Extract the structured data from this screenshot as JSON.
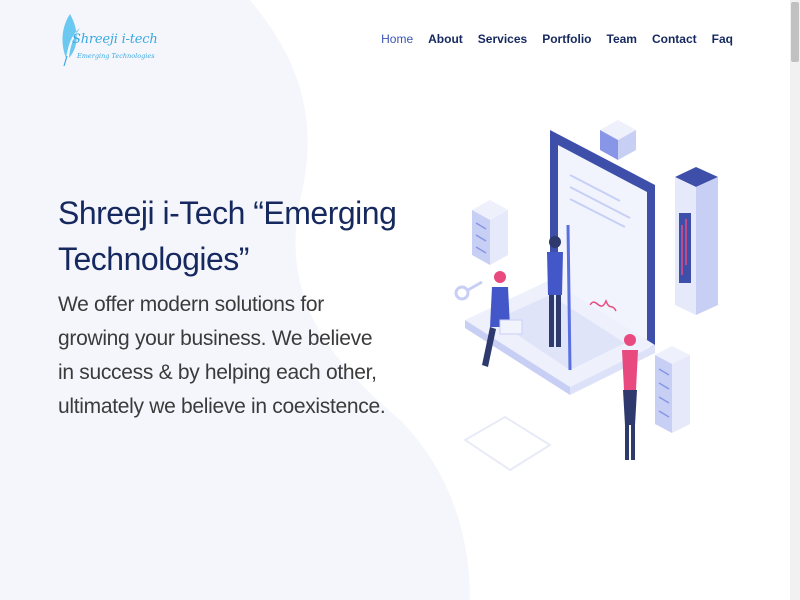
{
  "logo": {
    "name": "Shreeji i-tech",
    "tagline": "Emerging Technologies"
  },
  "nav": {
    "items": [
      {
        "label": "Home",
        "active": true
      },
      {
        "label": "About"
      },
      {
        "label": "Services"
      },
      {
        "label": "Portfolio"
      },
      {
        "label": "Team"
      },
      {
        "label": "Contact"
      },
      {
        "label": "Faq"
      }
    ]
  },
  "hero": {
    "title": "Shreeji i-Tech “Emerging Technologies”",
    "subtitle": "We offer modern solutions for growing your business. We believe in success & by helping each other, ultimately we believe in coexistence."
  },
  "colors": {
    "brand_navy": "#16295f",
    "nav_active": "#3a55b5",
    "logo_blue": "#3aa8e0",
    "accent_pink": "#e84a7f",
    "illustration_blue": "#5a6fe0"
  }
}
